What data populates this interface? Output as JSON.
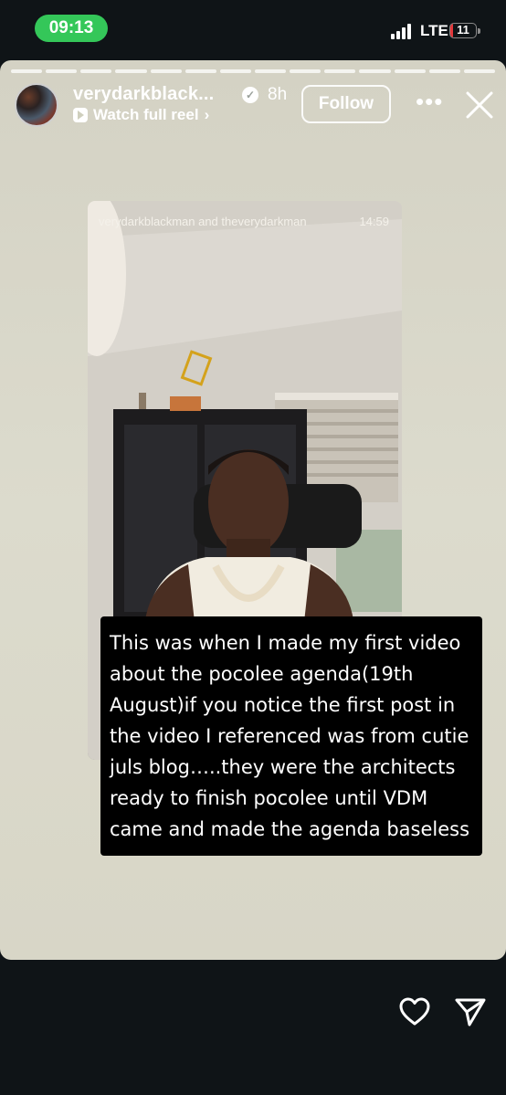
{
  "status": {
    "time": "09:13",
    "network": "LTE",
    "battery": "11",
    "battery_level": 0.11,
    "accent": "#34c759"
  },
  "story": {
    "username": "verydarkblack...",
    "verified_icon": "verified-badge-icon",
    "age": "8h",
    "reel_link": "Watch full reel",
    "reel_chevron": "›",
    "follow_label": "Follow",
    "more_icon": "•••",
    "progress_segments": 14
  },
  "video": {
    "header": "verydarkblackman and theverydarkman",
    "time": "14:59"
  },
  "caption": {
    "text": "This was when I made my first video about the pocolee agenda(19th August)if you notice the first post in the video I referenced was from cutie juls blog…..they were the architects ready to finish pocolee until VDM came and made the agenda baseless"
  },
  "actions": {
    "like_icon": "heart-icon",
    "share_icon": "send-icon"
  }
}
